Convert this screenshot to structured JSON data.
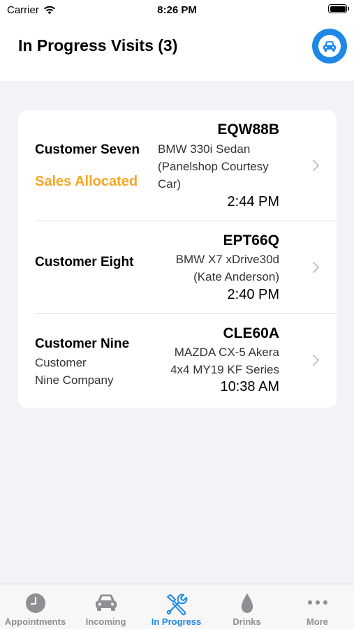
{
  "status_bar": {
    "carrier": "Carrier",
    "time": "8:26 PM"
  },
  "header": {
    "title": "In Progress Visits (3)",
    "action_icon": "car-icon"
  },
  "visits": [
    {
      "customer": "Customer Seven",
      "status": "Sales Allocated",
      "plate": "EQW88B",
      "vehicle_lines": [
        "BMW 330i Sedan",
        "(Panelshop Courtesy",
        "Car)"
      ],
      "time": "2:44 PM"
    },
    {
      "customer": "Customer Eight",
      "plate": "EPT66Q",
      "vehicle_lines": [
        "BMW X7 xDrive30d",
        "(Kate Anderson)"
      ],
      "time": "2:40 PM"
    },
    {
      "customer": "Customer Nine",
      "company_lines": [
        "Customer",
        "Nine Company"
      ],
      "plate": "CLE60A",
      "vehicle_lines": [
        "MAZDA CX-5 Akera",
        "4x4 MY19 KF Series"
      ],
      "time": "10:38 AM"
    }
  ],
  "tabs": [
    {
      "label": "Appointments",
      "icon": "clock-icon"
    },
    {
      "label": "Incoming",
      "icon": "car-icon"
    },
    {
      "label": "In Progress",
      "icon": "tools-icon",
      "active": true
    },
    {
      "label": "Drinks",
      "icon": "drop-icon"
    },
    {
      "label": "More",
      "icon": "more-icon"
    }
  ],
  "colors": {
    "accent": "#1E88E5",
    "status_orange": "#F5A623",
    "background": "#F2F2F7"
  }
}
